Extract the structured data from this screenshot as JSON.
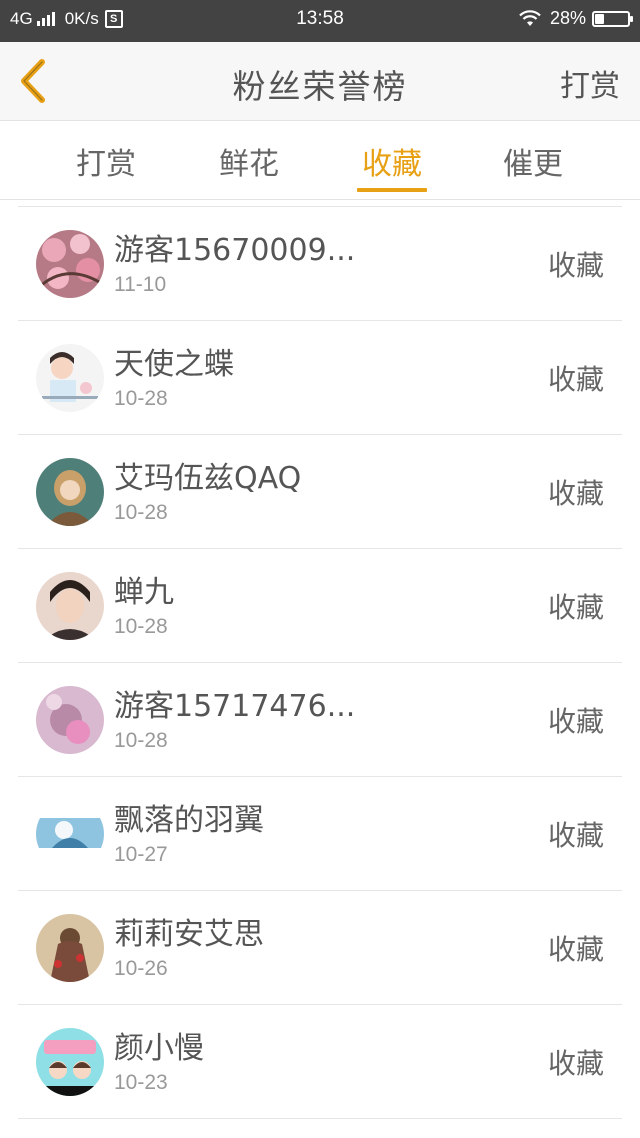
{
  "status_bar": {
    "network": "4G",
    "speed": "0K/s",
    "speed_badge": "S",
    "time": "13:58",
    "battery_percent": "28%",
    "battery_level": 0.28
  },
  "nav": {
    "title": "粉丝荣誉榜",
    "action": "打赏",
    "back_icon": "chevron-left-icon",
    "accent_color": "#e8a015"
  },
  "tabs": [
    {
      "label": "打赏",
      "active": false
    },
    {
      "label": "鲜花",
      "active": false
    },
    {
      "label": "收藏",
      "active": true
    },
    {
      "label": "催更",
      "active": false
    }
  ],
  "list": [
    {
      "name": "游客15670009...",
      "date": "11-10",
      "action": "收藏"
    },
    {
      "name": "天使之蝶",
      "date": "10-28",
      "action": "收藏"
    },
    {
      "name": "艾玛伍兹QAQ",
      "date": "10-28",
      "action": "收藏"
    },
    {
      "name": "蝉九",
      "date": "10-28",
      "action": "收藏"
    },
    {
      "name": "游客15717476...",
      "date": "10-28",
      "action": "收藏"
    },
    {
      "name": "飘落的羽翼",
      "date": "10-27",
      "action": "收藏"
    },
    {
      "name": "莉莉安艾思",
      "date": "10-26",
      "action": "收藏"
    },
    {
      "name": "颜小慢",
      "date": "10-23",
      "action": "收藏"
    }
  ]
}
